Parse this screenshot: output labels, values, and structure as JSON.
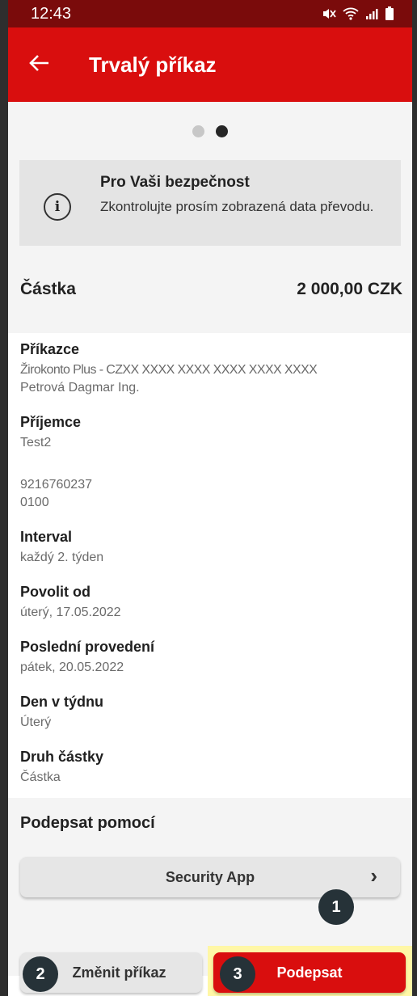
{
  "status_bar": {
    "time": "12:43",
    "icons": [
      "mute-icon",
      "wifi-icon",
      "signal-icon",
      "battery-icon"
    ]
  },
  "app_bar": {
    "title": "Trvalý příkaz"
  },
  "pager": {
    "total": 2,
    "active": 2
  },
  "info": {
    "title": "Pro Vaši bezpečnost",
    "text": "Zkontrolujte prosím zobrazená data převodu."
  },
  "amount": {
    "label": "Částka",
    "value": "2 000,00 CZK"
  },
  "fields": {
    "payer": {
      "label": "Příkazce",
      "line1": "Žirokonto Plus - CZXX XXXX XXXX XXXX XXXX XXXX",
      "line2": "Petrová Dagmar Ing."
    },
    "payee": {
      "label": "Příjemce",
      "line1": "Test2"
    },
    "account": {
      "number": "9216760237",
      "bank": "0100"
    },
    "interval": {
      "label": "Interval",
      "value": "každý 2. týden"
    },
    "valid_from": {
      "label": "Povolit od",
      "value": "úterý, 17.05.2022"
    },
    "last_exec": {
      "label": "Poslední provedení",
      "value": "pátek, 20.05.2022"
    },
    "weekday": {
      "label": "Den v týdnu",
      "value": "Úterý"
    },
    "amount_type": {
      "label": "Druh částky",
      "value": "Částka"
    }
  },
  "signing": {
    "label": "Podepsat pomocí",
    "method": "Security App",
    "chevron": "›"
  },
  "actions": {
    "change": "Změnit příkaz",
    "sign": "Podepsat"
  },
  "badges": {
    "b1": "1",
    "b2": "2",
    "b3": "3"
  },
  "colors": {
    "brand_red": "#d90e0e",
    "status_bar": "#7a0b0b",
    "highlight": "#fff7a6"
  }
}
